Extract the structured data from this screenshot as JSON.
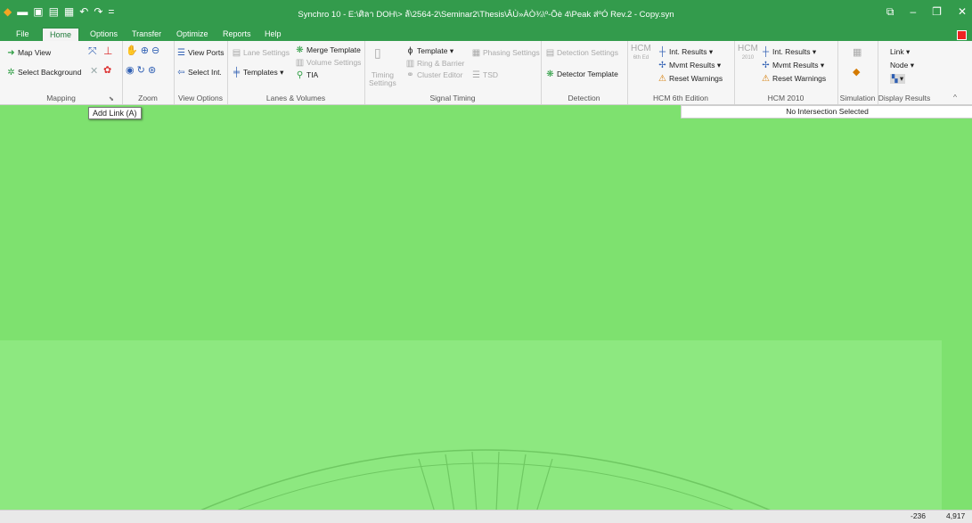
{
  "window": {
    "title": "Synchro 10 - E:\\ศิลา DOH\\> ล้\\2564-2\\Seminar2\\Thesis\\ÂÙ»ÀÒ¾\\º-Õè 4\\Peak ส่ºÓ Rev.2 - Copy.syn",
    "controls": [
      "⧉",
      "–",
      "❐",
      "✕"
    ]
  },
  "qat_icons": [
    "◆",
    "▬",
    "▣",
    "▤",
    "▦",
    "↶",
    "↷",
    "="
  ],
  "menu_tabs": [
    "File",
    "Home",
    "Options",
    "Transfer",
    "Optimize",
    "Reports",
    "Help"
  ],
  "ribbon": {
    "mapping": {
      "label": "Mapping",
      "map_view": "Map View",
      "select_background": "Select Background",
      "expand": "⬊"
    },
    "zoom": {
      "label": "Zoom"
    },
    "view_options": {
      "label": "View Options",
      "view_ports": "View Ports",
      "select_int": "Select Int."
    },
    "lanes": {
      "label": "Lanes & Volumes",
      "lane_settings": "Lane Settings",
      "merge_template": "Merge Template",
      "volume_settings": "Volume Settings",
      "templates": "Templates",
      "tia": "TIA"
    },
    "signal": {
      "label": "Signal Timing",
      "timing": "Timing",
      "settings": "Settings",
      "template": "Template",
      "phasing_settings": "Phasing Settings",
      "ring_barrier": "Ring & Barrier",
      "cluster_editor": "Cluster Editor",
      "tsd": "TSD"
    },
    "detection": {
      "label": "Detection",
      "detection_settings": "Detection Settings",
      "detector_template": "Detector Template"
    },
    "hcm6": {
      "label": "HCM 6th Edition",
      "logo": "HCM",
      "logo_sub": "6th Ed",
      "int_results": "Int. Results",
      "mvmt_results": "Mvmt Results",
      "reset_warnings": "Reset Warnings"
    },
    "hcm2010": {
      "label": "HCM 2010",
      "logo": "HCM",
      "logo_sub": "2010",
      "int_results": "Int. Results",
      "mvmt_results": "Mvmt Results",
      "reset_warnings": "Reset Warnings"
    },
    "simulation": {
      "label": "Simulation"
    },
    "display": {
      "label": "Display Results",
      "link": "Link",
      "node": "Node"
    },
    "collapse": "^"
  },
  "tooltip": "Add Link (A)",
  "info_bar": "No Intersection Selected",
  "status": {
    "x": "-236",
    "y": "4,917"
  },
  "colors": {
    "title_bar": "#339b4c",
    "canvas": "#7ee16f",
    "canvas_band": "#8de880"
  }
}
